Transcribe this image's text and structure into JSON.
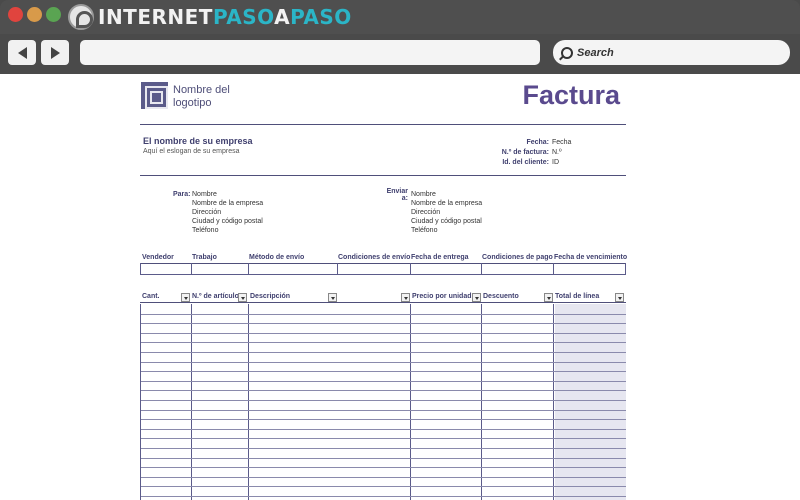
{
  "browser": {
    "brand_main": "INTERNET",
    "brand_accent": "PASO",
    "brand_outline": "A",
    "brand_end": "PASO",
    "search_label": "Search",
    "accent_color": "#2bb5c7"
  },
  "invoice": {
    "logo_text": "Nombre del logotipo",
    "title": "Factura",
    "company_name": "El nombre de su empresa",
    "slogan": "Aquí el eslogan de su empresa",
    "meta": [
      {
        "label": "Fecha:",
        "value": "Fecha"
      },
      {
        "label": "N.º de factura:",
        "value": "N.º"
      },
      {
        "label": "Id. del cliente:",
        "value": "ID"
      }
    ],
    "bill_to": {
      "label": "Para:",
      "lines": [
        "Nombre",
        "Nombre de la empresa",
        "Dirección",
        "Ciudad y código postal",
        "Teléfono"
      ]
    },
    "ship_to": {
      "label": "Enviar a:",
      "lines": [
        "Nombre",
        "Nombre de la empresa",
        "Dirección",
        "Ciudad y código postal",
        "Teléfono"
      ]
    },
    "order_headers": [
      "Vendedor",
      "Trabajo",
      "Método de envío",
      "Condiciones de envío",
      "Fecha de entrega",
      "Condiciones de pago",
      "Fecha de vencimiento"
    ],
    "item_headers": [
      "Cant.",
      "N.º de artículo",
      "Descripción",
      "Precio por unidad",
      "Descuento",
      "Total de línea"
    ],
    "brand_color": "#5a4a8e"
  }
}
